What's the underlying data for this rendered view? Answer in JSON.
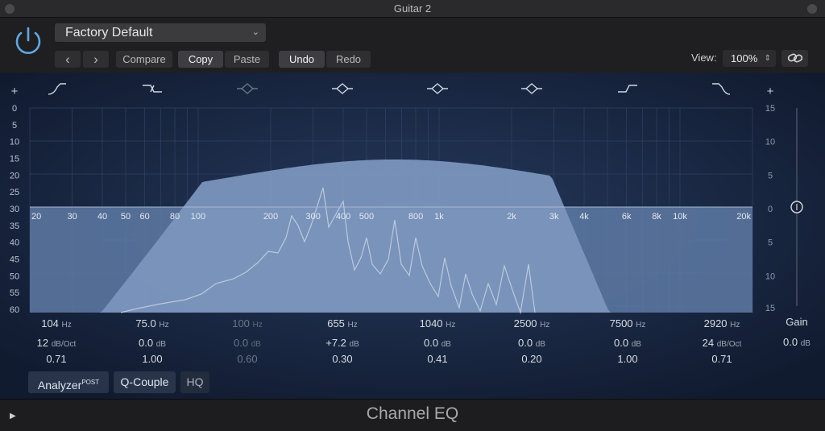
{
  "window": {
    "title": "Guitar 2"
  },
  "header": {
    "preset": "Factory Default",
    "compare_label": "Compare",
    "copy_label": "Copy",
    "paste_label": "Paste",
    "undo_label": "Undo",
    "redo_label": "Redo",
    "view_label": "View:",
    "zoom": "100%",
    "prev_glyph": "‹",
    "next_glyph": "›"
  },
  "colors": {
    "accent": "#5fa8e6",
    "curve_fill": "#7b95bd",
    "background": "#13203a"
  },
  "graph": {
    "plus_left": "+",
    "plus_right": "+",
    "freq_min": 20,
    "freq_max": 20000,
    "left_scale": [
      "0",
      "5",
      "10",
      "15",
      "20",
      "25",
      "30",
      "35",
      "40",
      "45",
      "50",
      "55",
      "60"
    ],
    "right_scale": [
      "15",
      "10",
      "5",
      "0",
      "5",
      "10",
      "15"
    ],
    "freq_labels": [
      "20",
      "30",
      "40",
      "50",
      "60",
      "80",
      "100",
      "200",
      "300",
      "400",
      "500",
      "800",
      "1k",
      "2k",
      "3k",
      "4k",
      "6k",
      "8k",
      "10k",
      "20k"
    ],
    "freq_label_values": [
      20,
      30,
      40,
      50,
      60,
      80,
      100,
      200,
      300,
      400,
      500,
      800,
      1000,
      2000,
      3000,
      4000,
      6000,
      8000,
      10000,
      20000
    ],
    "gain_value": 0.0
  },
  "bands": [
    {
      "type": "low-cut",
      "freq": "104",
      "freq_unit": "Hz",
      "gain": "12",
      "gain_unit": "dB/Oct",
      "q": "0.71",
      "enabled": true
    },
    {
      "type": "low-shelf",
      "freq": "75.0",
      "freq_unit": "Hz",
      "gain": "0.0",
      "gain_unit": "dB",
      "q": "1.00",
      "enabled": true
    },
    {
      "type": "bell",
      "freq": "100",
      "freq_unit": "Hz",
      "gain": "0.0",
      "gain_unit": "dB",
      "q": "0.60",
      "enabled": false
    },
    {
      "type": "bell",
      "freq": "655",
      "freq_unit": "Hz",
      "gain": "+7.2",
      "gain_unit": "dB",
      "q": "0.30",
      "enabled": true
    },
    {
      "type": "bell",
      "freq": "1040",
      "freq_unit": "Hz",
      "gain": "0.0",
      "gain_unit": "dB",
      "q": "0.41",
      "enabled": true
    },
    {
      "type": "bell",
      "freq": "2500",
      "freq_unit": "Hz",
      "gain": "0.0",
      "gain_unit": "dB",
      "q": "0.20",
      "enabled": true
    },
    {
      "type": "high-shelf",
      "freq": "7500",
      "freq_unit": "Hz",
      "gain": "0.0",
      "gain_unit": "dB",
      "q": "1.00",
      "enabled": true
    },
    {
      "type": "high-cut",
      "freq": "2920",
      "freq_unit": "Hz",
      "gain": "24",
      "gain_unit": "dB/Oct",
      "q": "0.71",
      "enabled": true
    }
  ],
  "gain_readout": {
    "label": "Gain",
    "value": "0.0",
    "unit": "dB"
  },
  "footer_buttons": {
    "analyzer": "Analyzer",
    "analyzer_mode": "POST",
    "q_couple": "Q-Couple",
    "hq": "HQ"
  },
  "footer": {
    "plugin_name": "Channel EQ",
    "play_glyph": "▶"
  }
}
